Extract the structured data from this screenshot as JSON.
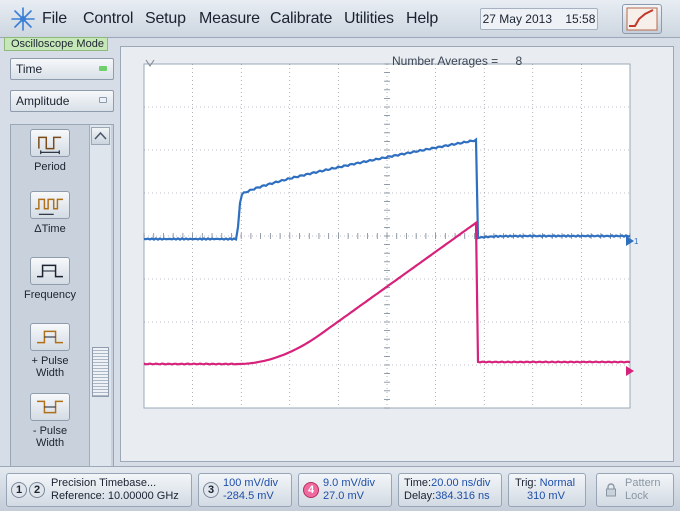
{
  "menu": {
    "file": "File",
    "control": "Control",
    "setup": "Setup",
    "measure": "Measure",
    "calibrate": "Calibrate",
    "utilities": "Utilities",
    "help": "Help"
  },
  "header": {
    "date": "27 May 2013",
    "time": "15:58",
    "mode": "Oscilloscope Mode"
  },
  "left_panel": {
    "time_dropdown": "Time",
    "amplitude_dropdown": "Amplitude",
    "measurements": [
      {
        "label": "Period"
      },
      {
        "label": "ΔTime"
      },
      {
        "label": "Frequency"
      },
      {
        "label_line1": "+ Pulse",
        "label_line2": "Width"
      },
      {
        "label_line1": "- Pulse",
        "label_line2": "Width"
      }
    ]
  },
  "display": {
    "averages_label": "Number Averages =",
    "averages_value": "8",
    "ch1_marker": "1",
    "trace_colors": {
      "ch3": "#2f6fc0",
      "ch4": "#d6227a"
    },
    "background": "#ffffff",
    "grid_color": "#7a8592"
  },
  "status": {
    "timebase": {
      "title": "Precision Timebase...",
      "reference_label": "Reference:",
      "reference_value": "10.00000 GHz",
      "chip1": "1",
      "chip2": "2"
    },
    "ch3": {
      "chip": "3",
      "scale": "100 mV/div",
      "offset": "-284.5 mV"
    },
    "ch4": {
      "chip": "4",
      "scale": "9.0 mV/div",
      "offset": "27.0 mV"
    },
    "time": {
      "time_label": "Time:",
      "time_value": "20.00 ns/div",
      "delay_label": "Delay:",
      "delay_value": "384.316 ns"
    },
    "trigger": {
      "trig_label": "Trig:",
      "trig_value": "Normal",
      "level": "310 mV"
    },
    "pattern_lock": {
      "line1": "Pattern",
      "line2": "Lock"
    }
  }
}
